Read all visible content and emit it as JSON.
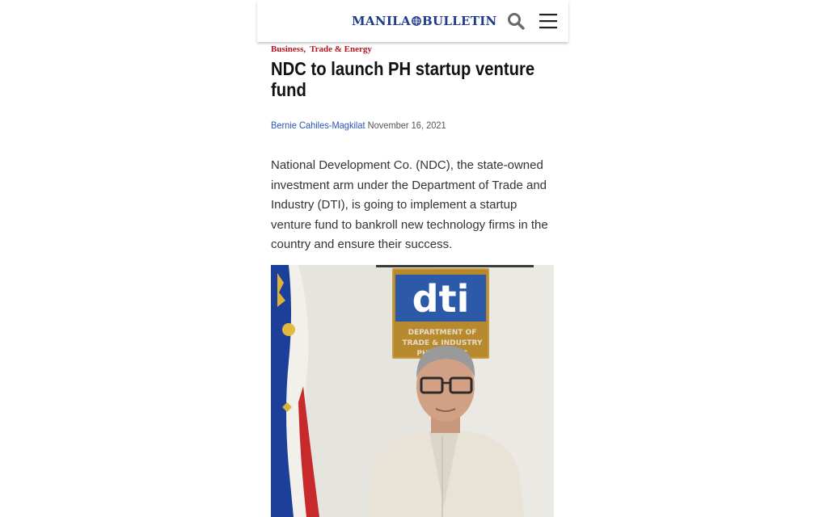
{
  "header": {
    "logo_left": "MANILA",
    "logo_right": "BULLETIN",
    "brand_color": "#1f3a8c",
    "search_icon": "search-icon",
    "menu_icon": "hamburger-menu-icon"
  },
  "article": {
    "categories": [
      "Business,",
      "Trade & Energy"
    ],
    "category_color": "#b4141f",
    "title": "NDC to launch PH startup venture fund",
    "author": "Bernie Cahiles-Magkilat",
    "date": "November 16, 2021",
    "lede": "National Development Co. (NDC), the state-owned investment arm under the Department of Trade and Industry (DTI), is going to implement a startup venture fund to bankroll new technology firms in the country and ensure their success."
  },
  "photo": {
    "sign_logo": "dti",
    "sign_line1": "DEPARTMENT OF",
    "sign_line2": "TRADE & INDUSTRY",
    "sign_line3": "PHILIPPINES"
  }
}
